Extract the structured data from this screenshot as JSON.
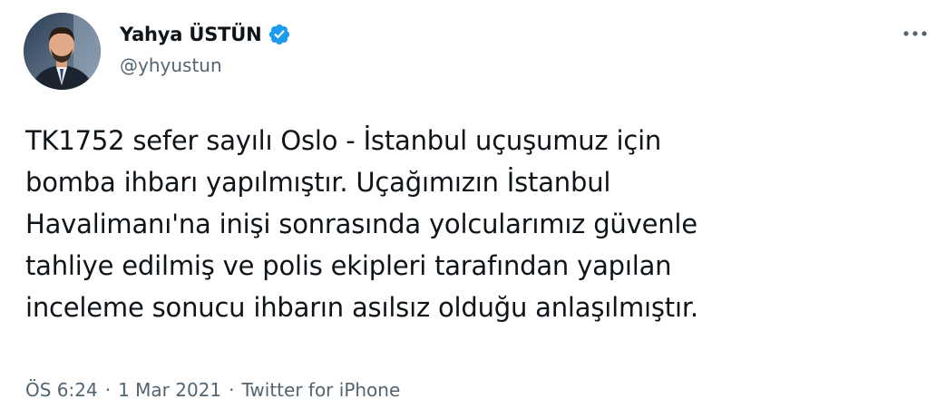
{
  "author": {
    "display_name": "Yahya ÜSTÜN",
    "handle": "@yhyustun",
    "verified": true
  },
  "icons": {
    "verified": "verified-badge-icon",
    "more": "more-options-icon"
  },
  "colors": {
    "text": "#0f1419",
    "muted": "#536471",
    "verified": "#1d9bf0"
  },
  "tweet": {
    "text": "TK1752 sefer sayılı Oslo - İstanbul uçuşumuz için\nbomba ihbarı yapılmıştır. Uçağımızın İstanbul\nHavalimanı'na inişi sonrasında yolcularımız güvenle\ntahliye edilmiş ve polis ekipleri tarafından yapılan\ninceleme sonucu ihbarın asılsız olduğu anlaşılmıştır.",
    "time": "ÖS 6:24",
    "separator": "·",
    "date": "1 Mar 2021",
    "source": "Twitter for iPhone"
  }
}
